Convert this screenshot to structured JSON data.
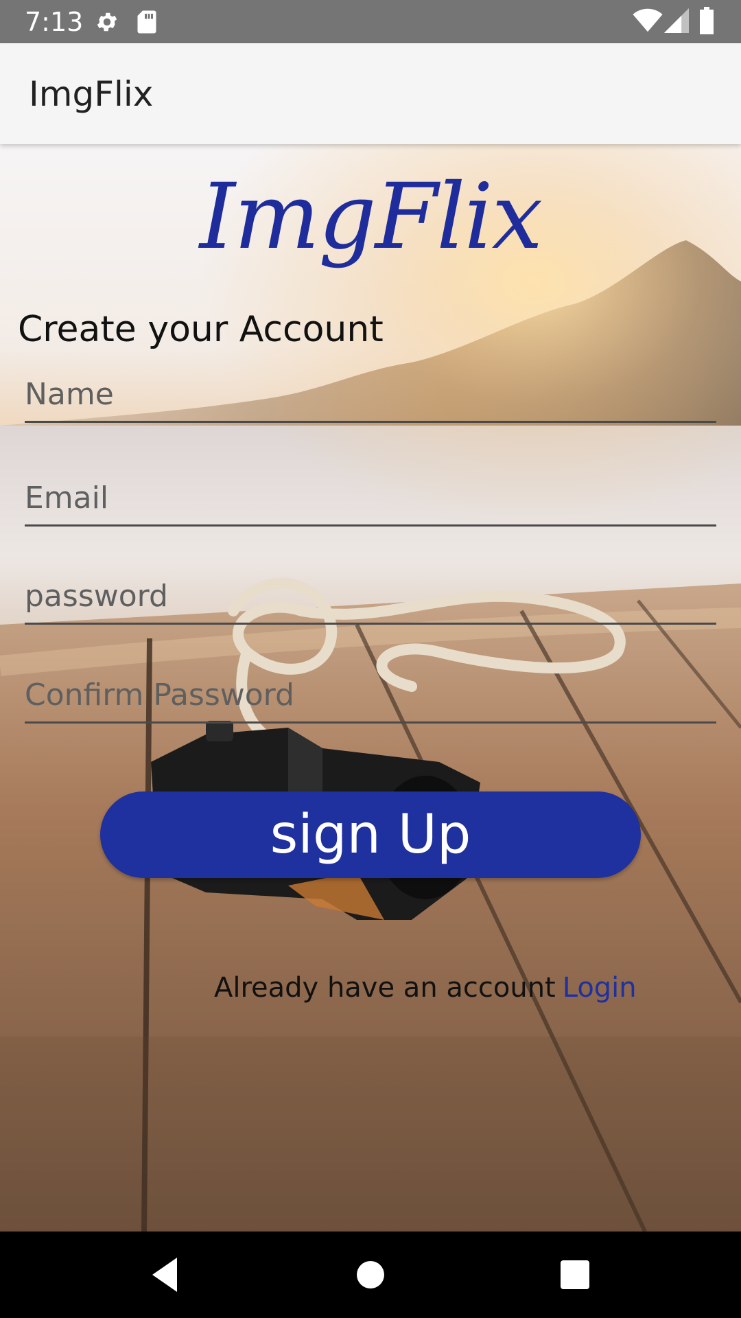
{
  "status_bar": {
    "time": "7:13",
    "icons_left": [
      "gear-icon",
      "sd-card-icon"
    ],
    "icons_right": [
      "wifi-icon",
      "signal-icon",
      "battery-icon"
    ]
  },
  "app_bar": {
    "title": "ImgFlix"
  },
  "logo": {
    "text": "ImgFlix",
    "color": "#1f2d9c"
  },
  "form": {
    "heading": "Create your Account",
    "fields": [
      {
        "name": "name",
        "placeholder": "Name",
        "value": ""
      },
      {
        "name": "email",
        "placeholder": "Email",
        "value": ""
      },
      {
        "name": "password",
        "placeholder": "password",
        "value": ""
      },
      {
        "name": "confirm_password",
        "placeholder": "Confirm Password",
        "value": ""
      }
    ],
    "submit_label": "sign Up",
    "login_prompt": "Already have an account",
    "login_link": "Login"
  },
  "colors": {
    "accent": "#1f309f",
    "status_bar": "#757575",
    "app_bar": "#f5f5f5",
    "nav_bar": "#000000"
  },
  "nav_bar": {
    "buttons": [
      "back-icon",
      "home-icon",
      "recents-icon"
    ]
  }
}
